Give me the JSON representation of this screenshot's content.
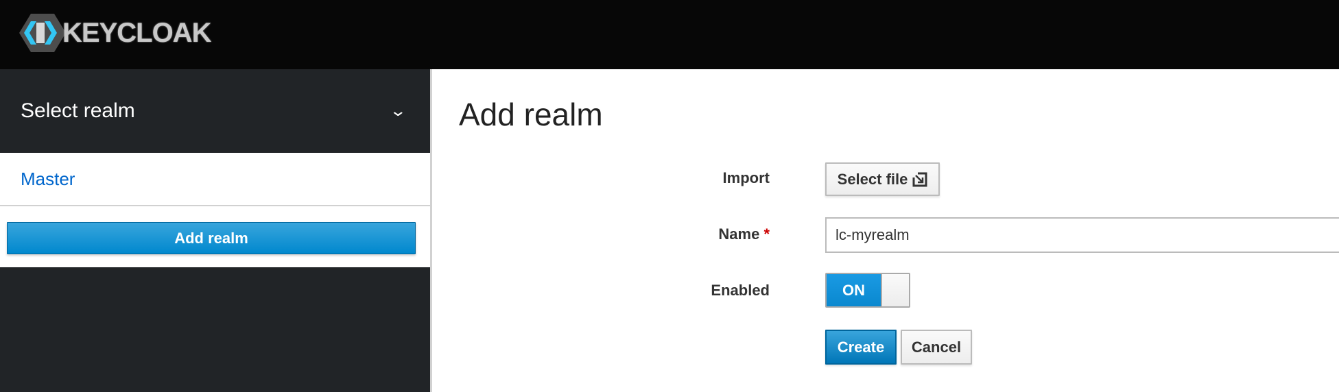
{
  "header": {
    "brand": "KEYCLOAK"
  },
  "sidebar": {
    "realm_selector": "Select realm",
    "realms": [
      {
        "label": "Master"
      }
    ],
    "add_realm_label": "Add realm"
  },
  "main": {
    "title": "Add realm",
    "form": {
      "import_label": "Import",
      "select_file_label": "Select file",
      "name_label": "Name",
      "name_required": "*",
      "name_value": "lc-myrealm",
      "enabled_label": "Enabled",
      "enabled_state": "ON",
      "create_label": "Create",
      "cancel_label": "Cancel"
    }
  },
  "colors": {
    "accent": "#0088ce",
    "link": "#0066cc",
    "sidebar": "#212427",
    "header": "#070707"
  }
}
